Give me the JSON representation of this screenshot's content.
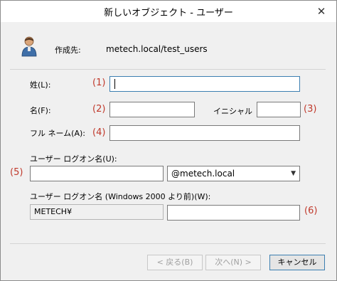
{
  "window": {
    "title": "新しいオブジェクト - ユーザー",
    "close_symbol": "✕"
  },
  "header": {
    "created_in_label": "作成先:",
    "created_in_value": "metech.local/test_users",
    "icon": "user-icon"
  },
  "fields": {
    "last_name": {
      "label": "姓(L):",
      "value": ""
    },
    "first_name": {
      "label": "名(F):",
      "value": ""
    },
    "initials": {
      "label": "イニシャル",
      "value": ""
    },
    "full_name": {
      "label": "フル ネーム(A):",
      "value": ""
    },
    "logon_name": {
      "label": "ユーザー ログオン名(U):",
      "value": "",
      "domain": "@metech.local"
    },
    "pre2000_logon": {
      "label": "ユーザー ログオン名 (Windows 2000 より前)(W):",
      "prefix": "METECH¥",
      "value": ""
    }
  },
  "annotations": {
    "a1": "(1)",
    "a2": "(2)",
    "a3": "(3)",
    "a4": "(4)",
    "a5": "(5)",
    "a6": "(6)",
    "color": "#c0392b"
  },
  "buttons": {
    "back": "< 戻る(B)",
    "next": "次へ(N) >",
    "cancel": "キャンセル"
  }
}
